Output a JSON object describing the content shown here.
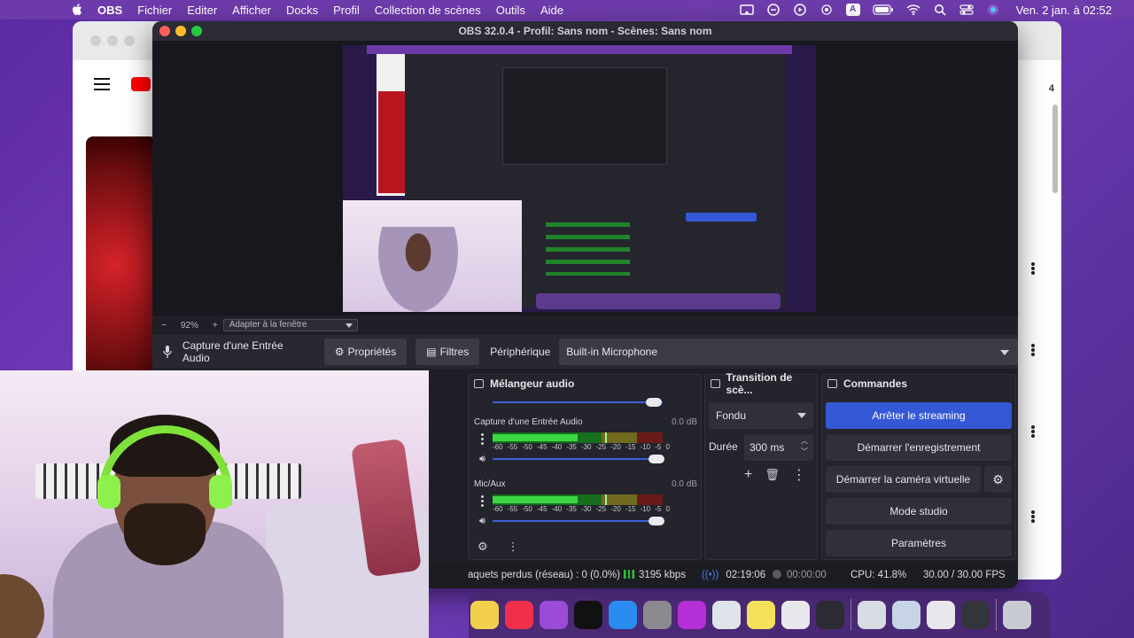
{
  "menubar": {
    "app_name": "OBS",
    "items": [
      "Fichier",
      "Editer",
      "Afficher",
      "Docks",
      "Profil",
      "Collection de scènes",
      "Outils",
      "Aide"
    ],
    "clock": "Ven. 2 jan. à  02:52",
    "status_icons": [
      "screen-mirror-icon",
      "vpn-icon",
      "play-icon",
      "airdrop-icon",
      "input-source-icon",
      "battery-icon",
      "wifi-icon",
      "search-icon",
      "control-center-icon",
      "siri-icon"
    ],
    "input_source_label": "A"
  },
  "browser": {
    "side_badge": "4"
  },
  "obs": {
    "window_title": "OBS 32.0.4 - Profil: Sans nom - Scènes: Sans nom",
    "preview_toolbar": {
      "zoom_minus": "−",
      "zoom_percent": "92%",
      "zoom_plus": "+",
      "fit_mode": "Adapter à la fenêtre"
    },
    "source_bar": {
      "source_name": "Capture d'une Entrée Audio",
      "properties_label": "Propriétés",
      "filters_label": "Filtres",
      "device_label": "Périphérique",
      "device_value": "Built-in Microphone"
    },
    "mixer": {
      "title": "Mélangeur audio",
      "channels": [
        {
          "name": "Capture d'une Entrée Audio",
          "db": "0.0 dB",
          "level": 0.5,
          "peak": 0.66
        },
        {
          "name": "Mic/Aux",
          "db": "0.0 dB",
          "level": 0.5,
          "peak": 0.66
        }
      ],
      "ticks": [
        "-60",
        "-55",
        "-50",
        "-45",
        "-40",
        "-35",
        "-30",
        "-25",
        "-20",
        "-15",
        "-10",
        "-5",
        "0"
      ]
    },
    "transition": {
      "title": "Transition de scè...",
      "type": "Fondu",
      "duration_label": "Durée",
      "duration_value": "300 ms"
    },
    "commands": {
      "title": "Commandes",
      "stop_streaming": "Arrêter le streaming",
      "start_recording": "Démarrer l'enregistrement",
      "start_virtual_cam": "Démarrer la caméra virtuelle",
      "studio_mode": "Mode studio",
      "settings": "Paramètres"
    },
    "status": {
      "dropped_frames": "aquets perdus (réseau) : 0 (0.0%)",
      "bitrate": "3195 kbps",
      "stream_time": "02:19:06",
      "record_time": "00:00:00",
      "cpu": "CPU: 41.8%",
      "fps": "30.00 / 30.00 FPS"
    }
  },
  "dock_apps": [
    {
      "name": "notes-app-icon",
      "color": "#f2d04b"
    },
    {
      "name": "music-app-icon",
      "color": "#f0304a"
    },
    {
      "name": "podcasts-app-icon",
      "color": "#9c4bd8"
    },
    {
      "name": "apple-tv-app-icon",
      "color": "#111111"
    },
    {
      "name": "app-store-icon",
      "color": "#2a8cf0"
    },
    {
      "name": "system-settings-icon",
      "color": "#8a8a90"
    },
    {
      "name": "feedback-app-icon",
      "color": "#b52fd6"
    },
    {
      "name": "preview-app-icon",
      "color": "#dfe3ea"
    },
    {
      "name": "stickies-app-icon",
      "color": "#f4e05a"
    },
    {
      "name": "script-editor-icon",
      "color": "#e8e8ec"
    },
    {
      "name": "obs-app-icon",
      "color": "#2b2b33"
    },
    {
      "name": "finder-folder-icon",
      "color": "#d8dce4"
    },
    {
      "name": "desktop-folder-icon",
      "color": "#c6d4e6"
    },
    {
      "name": "downloads-folder-icon",
      "color": "#e8e8ec"
    },
    {
      "name": "screen-capture-icon",
      "color": "#34343c"
    },
    {
      "name": "trash-icon",
      "color": "#c9cbd2"
    }
  ]
}
